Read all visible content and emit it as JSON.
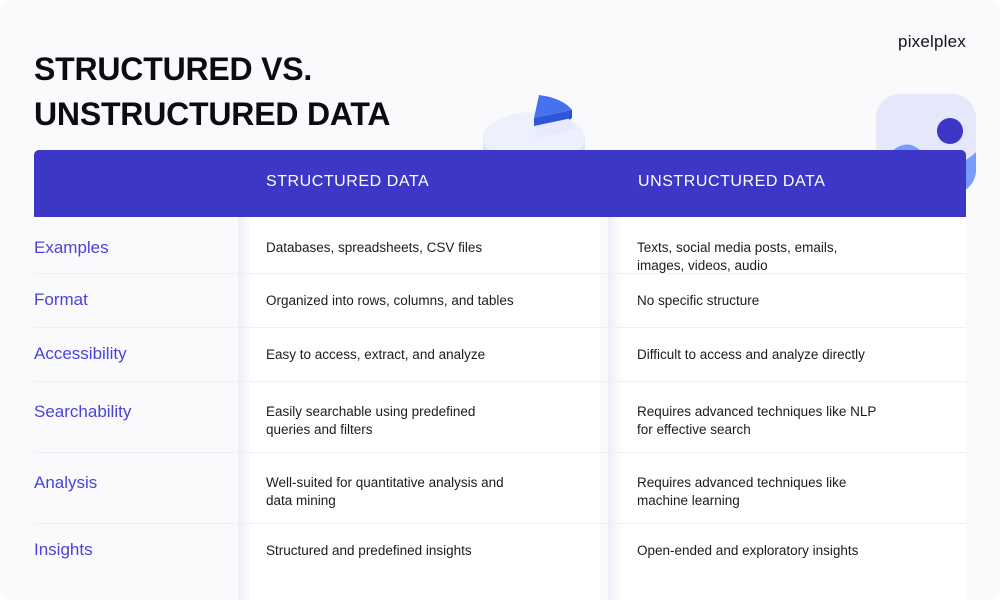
{
  "page": {
    "title": "STRUCTURED VS.\nUNSTRUCTURED DATA",
    "brand": "pixelplex",
    "background_color": "#fafafc",
    "accent_color": "#3c37c7",
    "label_color": "#4a43d8"
  },
  "decorations": [
    {
      "name": "pie-chart-illustration",
      "colors": [
        "#e6e9fb",
        "#f2f4fe",
        "#4f7df5",
        "#2f5fe0"
      ]
    },
    {
      "name": "image-placeholder-illustration",
      "colors": [
        "#e6e9fb",
        "#7a9bfb",
        "#3c37c7"
      ]
    }
  ],
  "table": {
    "headers": [
      "",
      "STRUCTURED DATA",
      "UNSTRUCTURED DATA"
    ],
    "rows": [
      {
        "label": "Examples",
        "structured": "Databases, spreadsheets, CSV files",
        "unstructured": "Texts, social media posts, emails,\nimages, videos, audio"
      },
      {
        "label": "Format",
        "structured": "Organized into rows, columns, and tables",
        "unstructured": "No specific structure"
      },
      {
        "label": "Accessibility",
        "structured": "Easy to access, extract, and analyze",
        "unstructured": "Difficult to access and analyze directly"
      },
      {
        "label": "Searchability",
        "structured": "Easily searchable using predefined\nqueries and filters",
        "unstructured": "Requires advanced techniques like NLP\nfor effective search"
      },
      {
        "label": "Analysis",
        "structured": "Well-suited for quantitative analysis and\ndata mining",
        "unstructured": "Requires advanced techniques like\nmachine learning"
      },
      {
        "label": "Insights",
        "structured": "Structured and predefined insights",
        "unstructured": "Open-ended and exploratory insights"
      }
    ]
  }
}
